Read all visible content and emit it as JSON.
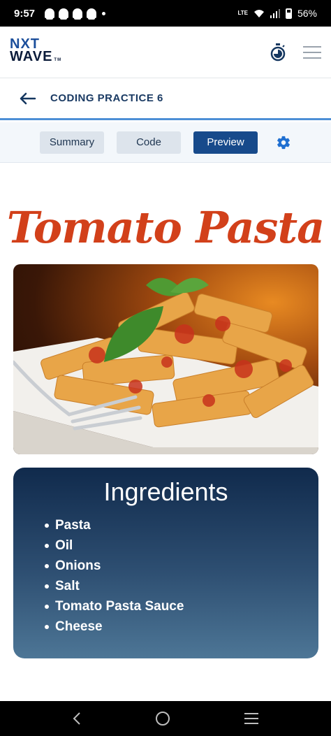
{
  "status_bar": {
    "time": "9:57",
    "network": "LTE",
    "battery": "56%"
  },
  "header": {
    "logo_line1": "NXT",
    "logo_line2": "WAVE",
    "logo_tm": "TM",
    "icons": [
      "stopwatch-icon",
      "hamburger-menu-icon"
    ]
  },
  "title_bar": {
    "back_icon": "arrow-left-icon",
    "title": "CODING PRACTICE 6"
  },
  "tabs": [
    {
      "label": "Summary",
      "active": false
    },
    {
      "label": "Code",
      "active": false
    },
    {
      "label": "Preview",
      "active": true
    }
  ],
  "settings_icon": "gear-icon",
  "preview": {
    "title": "Tomato Pasta",
    "image": "tomato-pasta-photo",
    "ingredients_heading": "Ingredients",
    "ingredients": [
      "Pasta",
      "Oil",
      "Onions",
      "Salt",
      "Tomato Pasta Sauce",
      "Cheese"
    ]
  },
  "nav_bar": {
    "icons": [
      "back-icon",
      "home-icon",
      "recents-icon"
    ]
  },
  "colors": {
    "brand_blue": "#174a8b",
    "title_red": "#d2401a",
    "accent_line": "#4d8fd6"
  }
}
